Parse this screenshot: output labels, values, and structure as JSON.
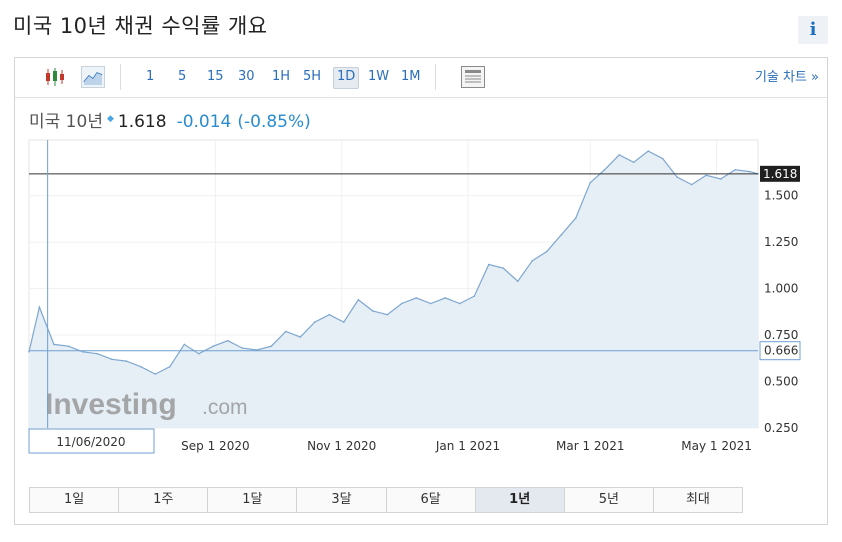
{
  "page": {
    "title": "미국 10년 채권 수익률 개요",
    "info_icon": "i"
  },
  "toolbar": {
    "ranges": [
      "1",
      "5",
      "15",
      "30",
      "1H",
      "5H",
      "1D",
      "1W",
      "1M"
    ],
    "active_range": "1D",
    "technical_label": "기술 차트 »",
    "icons": [
      "candlestick-icon",
      "line-chart-icon",
      "table-view-icon"
    ]
  },
  "quote": {
    "name": "미국 10년",
    "last": "1.618",
    "change": "-0.014",
    "change_pct": "(-0.85%)"
  },
  "chart": {
    "current_label": "1.618",
    "cursor_label": "0.666",
    "cursor_date": "11/06/2020",
    "watermark_main": "Investing",
    "watermark_suffix": ".com",
    "colors": {
      "line": "#7ea7cf",
      "fill": "#e6eef6",
      "current_line": "#333333",
      "cursor_line": "#6f9fd0",
      "label_bg": "#1f1f1f"
    }
  },
  "chart_data": {
    "type": "area",
    "y_ticks": [
      0.25,
      0.5,
      0.75,
      1.0,
      1.25,
      1.5
    ],
    "y_tick_labels": [
      "0.250",
      "0.500",
      "0.750",
      "1.000",
      "1.250",
      "1.500"
    ],
    "ylim": [
      0.25,
      1.8
    ],
    "x_tick_labels": [
      "Sep 1 2020",
      "Nov 1 2020",
      "Jan 1 2021",
      "Mar 1 2021",
      "May 1 2021"
    ],
    "x_tick_dates": [
      "2020-09-01",
      "2020-11-01",
      "2021-01-01",
      "2021-03-01",
      "2021-05-01"
    ],
    "x_range": [
      "2020-06-03",
      "2021-05-21"
    ],
    "series": [
      {
        "x": [
          "2020-06-03",
          "2020-06-08",
          "2020-06-15",
          "2020-06-22",
          "2020-06-29",
          "2020-07-06",
          "2020-07-13",
          "2020-07-20",
          "2020-07-27",
          "2020-08-03",
          "2020-08-10",
          "2020-08-17",
          "2020-08-24",
          "2020-08-31",
          "2020-09-07",
          "2020-09-14",
          "2020-09-21",
          "2020-09-28",
          "2020-10-05",
          "2020-10-12",
          "2020-10-19",
          "2020-10-26",
          "2020-11-02",
          "2020-11-09",
          "2020-11-16",
          "2020-11-23",
          "2020-11-30",
          "2020-12-07",
          "2020-12-14",
          "2020-12-21",
          "2020-12-28",
          "2021-01-04",
          "2021-01-11",
          "2021-01-18",
          "2021-01-25",
          "2021-02-01",
          "2021-02-08",
          "2021-02-15",
          "2021-02-22",
          "2021-03-01",
          "2021-03-08",
          "2021-03-15",
          "2021-03-22",
          "2021-03-29",
          "2021-04-05",
          "2021-04-12",
          "2021-04-19",
          "2021-04-26",
          "2021-05-03",
          "2021-05-10",
          "2021-05-17",
          "2021-05-21"
        ],
        "values": [
          0.66,
          0.9,
          0.7,
          0.69,
          0.66,
          0.65,
          0.62,
          0.61,
          0.58,
          0.54,
          0.58,
          0.7,
          0.65,
          0.69,
          0.72,
          0.68,
          0.67,
          0.69,
          0.77,
          0.74,
          0.82,
          0.86,
          0.82,
          0.94,
          0.88,
          0.86,
          0.92,
          0.95,
          0.92,
          0.95,
          0.92,
          0.96,
          1.13,
          1.11,
          1.04,
          1.15,
          1.2,
          1.29,
          1.38,
          1.57,
          1.64,
          1.72,
          1.68,
          1.74,
          1.7,
          1.6,
          1.56,
          1.61,
          1.59,
          1.64,
          1.63,
          1.618
        ]
      }
    ]
  },
  "periods": [
    "1일",
    "1주",
    "1달",
    "3달",
    "6달",
    "1년",
    "5년",
    "최대"
  ],
  "active_period": "1년"
}
